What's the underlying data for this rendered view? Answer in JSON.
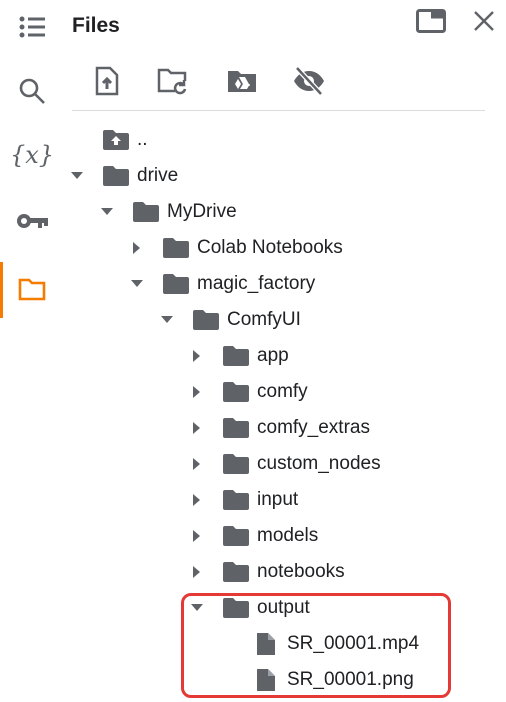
{
  "panel": {
    "title": "Files"
  },
  "rail": [
    "table-of-contents",
    "search",
    "variables",
    "secrets",
    "files"
  ],
  "accent": "#f57c00",
  "highlight_color": "#e53935",
  "tree": [
    {
      "label": "..",
      "level": 0,
      "type": "parent"
    },
    {
      "label": "drive",
      "level": 0,
      "type": "folder",
      "expanded": true
    },
    {
      "label": "MyDrive",
      "level": 1,
      "type": "folder",
      "expanded": true
    },
    {
      "label": "Colab Notebooks",
      "level": 2,
      "type": "folder",
      "expanded": false
    },
    {
      "label": "magic_factory",
      "level": 2,
      "type": "folder",
      "expanded": true
    },
    {
      "label": "ComfyUI",
      "level": 3,
      "type": "folder",
      "expanded": true
    },
    {
      "label": "app",
      "level": 4,
      "type": "folder",
      "expanded": false
    },
    {
      "label": "comfy",
      "level": 4,
      "type": "folder",
      "expanded": false
    },
    {
      "label": "comfy_extras",
      "level": 4,
      "type": "folder",
      "expanded": false
    },
    {
      "label": "custom_nodes",
      "level": 4,
      "type": "folder",
      "expanded": false
    },
    {
      "label": "input",
      "level": 4,
      "type": "folder",
      "expanded": false
    },
    {
      "label": "models",
      "level": 4,
      "type": "folder",
      "expanded": false
    },
    {
      "label": "notebooks",
      "level": 4,
      "type": "folder",
      "expanded": false
    },
    {
      "label": "output",
      "level": 4,
      "type": "folder",
      "expanded": true
    },
    {
      "label": "SR_00001.mp4",
      "level": 5,
      "type": "file"
    },
    {
      "label": "SR_00001.png",
      "level": 5,
      "type": "file"
    }
  ]
}
